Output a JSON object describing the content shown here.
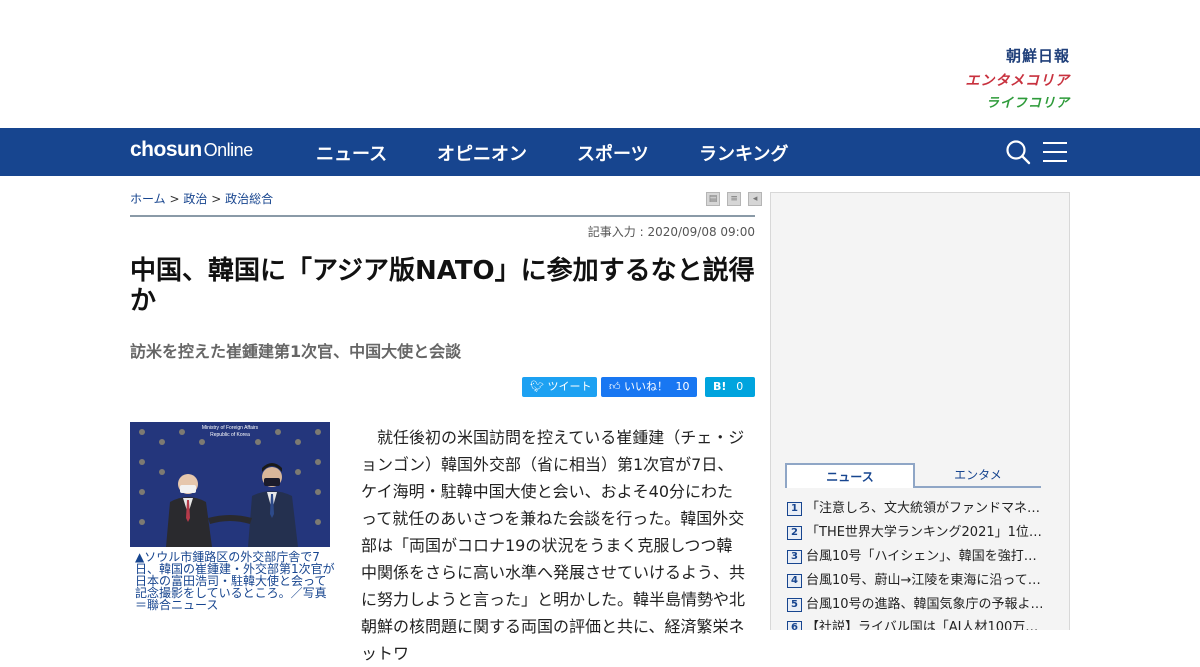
{
  "brands": {
    "chosun": "朝鮮日報",
    "enta": "エンタメコリア",
    "life": "ライフコリア"
  },
  "nav": {
    "logo_bold": "chosun",
    "logo_light": "Online",
    "items": [
      "ニュース",
      "オピニオン",
      "スポーツ",
      "ランキング"
    ],
    "search_icon": "search-icon",
    "menu_icon": "hamburger-menu-icon"
  },
  "breadcrumb": {
    "home": "ホーム",
    "sep": ">",
    "category": "政治",
    "subcategory": "政治総合"
  },
  "article": {
    "date": "記事入力 : 2020/09/08 09:00",
    "title": "中国、韓国に「アジア版NATO」に参加するなと説得か",
    "subtitle": "訪米を控えた崔鍾建第1次官、中国大使と会談",
    "photo_backdrop_line1": "Ministry of Foreign Affairs",
    "photo_backdrop_line2": "Republic of Korea",
    "photo_caption": "▲ソウル市鍾路区の外交部庁舎で7日、韓国の崔鍾建・外交部第1次官が日本の富田浩司・駐韓大使と会って記念撮影をしているところ。／写真＝聯合ニュース",
    "body": "　就任後初の米国訪問を控えている崔鍾建（チェ・ジョンゴン）韓国外交部（省に相当）第1次官が7日、ケイ海明・駐韓中国大使と会い、およそ40分にわたって就任のあいさつを兼ねた会談を行った。韓国外交部は「両国がコロナ19の状況をうまく克服しつつ韓中関係をさらに高い水準へ発展させていけるよう、共に努力しようと言った」と明かした。韓半島情勢や北朝鮮の核問題に関する両国の評価と共に、経済繁栄ネットワ"
  },
  "share": {
    "tweet": "ツイート",
    "like": "いいね！",
    "like_count": "10",
    "hatena": "B!",
    "hatena_count": "0"
  },
  "sidebar": {
    "tabs": [
      "ニュース",
      "エンタメ"
    ],
    "ranking": [
      {
        "rank": "1",
        "title": "「注意しろ、文大統領がファンドマネ…"
      },
      {
        "rank": "2",
        "title": "「THE世界大学ランキング2021」1位…"
      },
      {
        "rank": "3",
        "title": "台風10号「ハイシェン」、韓国を強打…"
      },
      {
        "rank": "4",
        "title": "台風10号、蔚山→江陵を東海に沿って…"
      },
      {
        "rank": "5",
        "title": "台風10号の進路、韓国気象庁の予報よ…"
      },
      {
        "rank": "6",
        "title": "【社説】ライバル国は「AI人材100万…"
      }
    ]
  },
  "colors": {
    "nav_bg": "#17458f",
    "link": "#17458f",
    "twitter": "#1da1f2",
    "facebook": "#1877f2",
    "hatena": "#00a4de"
  }
}
